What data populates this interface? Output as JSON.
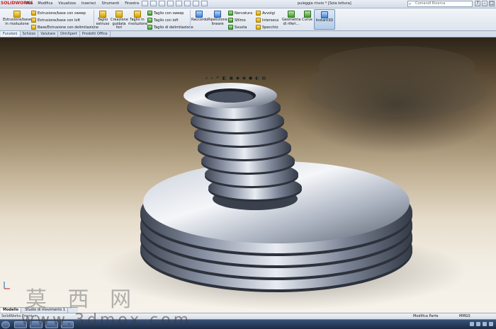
{
  "app": {
    "logo": "SOLIDWORKS",
    "document_title": "puleggia rinvio * [Sola lettura]"
  },
  "menu": [
    "File",
    "Modifica",
    "Visualizza",
    "Inserisci",
    "Strumenti",
    "Finestra"
  ],
  "search": {
    "placeholder": "Comandi Ricerca"
  },
  "ribbon": {
    "extrude_boss": "Estrusione/base in rivoluzione",
    "sweep": "Estrusione/base con sweep",
    "loft": "Estrusione/base con loft",
    "boundary": "Base/Estrusione con delimitazione",
    "cut_extrude": "Taglio estruso",
    "hole_wizard": "Creazione guidata fori",
    "cut_revolve": "Taglio in rivoluzione",
    "cut_sweep": "Taglio con sweep",
    "cut_loft": "Taglio con loft",
    "cut_boundary": "Taglio di delimitazione",
    "fillet": "Raccordo",
    "pattern": "Ripetizione lineare",
    "rib": "Nervatura",
    "shell": "Sfilmo",
    "draft": "Svuota",
    "wrap": "Avvolgi",
    "intersect": "Interseca",
    "mirror": "Specchio",
    "ref_geometry": "Geometria di riferi...",
    "curves": "Curve",
    "instant3d": "Instant3D"
  },
  "tabs": [
    "Funzioni",
    "Schizzo",
    "Valutare",
    "DimXpert",
    "Prodotti Office"
  ],
  "bottom_tabs": [
    "Modello",
    "Studio di movimento 1"
  ],
  "status": {
    "left": "SolidWorks Premium",
    "mode": "Modifica Parte",
    "units": "MMGS"
  },
  "watermark": {
    "chars": "莫 西 网",
    "url": "www.3dmox.com"
  },
  "colors": {
    "accent": "#3a7ed8",
    "logo_red": "#c41a1a"
  }
}
